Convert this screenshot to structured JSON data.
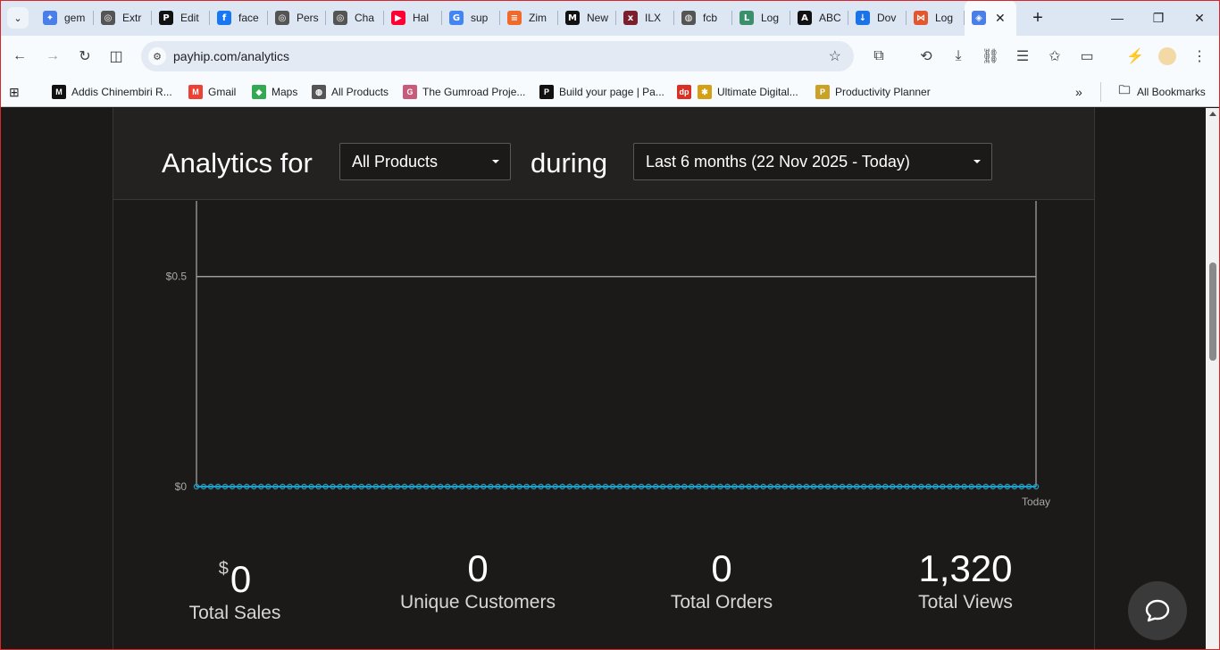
{
  "browser": {
    "tabs": [
      {
        "label": "gem",
        "icon": "gemini-icon",
        "color": "#4a7fe8",
        "glyph": "✦"
      },
      {
        "label": "Extr",
        "icon": "chatgpt-icon",
        "color": "#555",
        "glyph": "◎"
      },
      {
        "label": "Edit",
        "icon": "payhip-icon",
        "color": "#111",
        "glyph": "P"
      },
      {
        "label": "face",
        "icon": "facebook-icon",
        "color": "#1877f2",
        "glyph": "f"
      },
      {
        "label": "Pers",
        "icon": "chatgpt-icon",
        "color": "#555",
        "glyph": "◎"
      },
      {
        "label": "Cha",
        "icon": "chatgpt-icon",
        "color": "#555",
        "glyph": "◎"
      },
      {
        "label": "Hal",
        "icon": "youtube-icon",
        "color": "#ff0033",
        "glyph": "▶"
      },
      {
        "label": "sup",
        "icon": "google-icon",
        "color": "#4285f4",
        "glyph": "G"
      },
      {
        "label": "Zim",
        "icon": "zim-icon",
        "color": "#f06a2b",
        "glyph": "≡"
      },
      {
        "label": "New",
        "icon": "medium-icon",
        "color": "#111",
        "glyph": "M"
      },
      {
        "label": "ILX",
        "icon": "ilx-icon",
        "color": "#7a1f2b",
        "glyph": "x"
      },
      {
        "label": "fcb",
        "icon": "globe-icon",
        "color": "#555",
        "glyph": "◍"
      },
      {
        "label": "Log",
        "icon": "login-icon",
        "color": "#3b8f6a",
        "glyph": "L"
      },
      {
        "label": "ABC",
        "icon": "abc-icon",
        "color": "#111",
        "glyph": "A"
      },
      {
        "label": "Dov",
        "icon": "download-icon",
        "color": "#1a73e8",
        "glyph": "↓"
      },
      {
        "label": "Log",
        "icon": "bowtie-icon",
        "color": "#e4572e",
        "glyph": "⋈"
      }
    ],
    "active_tab_icon": "payhip-shield-icon",
    "url": "payhip.com/analytics",
    "bookmarks": [
      {
        "label": "Addis Chinembiri R...",
        "icon": "medium-icon",
        "color": "#111",
        "glyph": "M"
      },
      {
        "label": "Gmail",
        "icon": "gmail-icon",
        "color": "#ea4335",
        "glyph": "M"
      },
      {
        "label": "Maps",
        "icon": "maps-icon",
        "color": "#34a853",
        "glyph": "◆"
      },
      {
        "label": "All Products",
        "icon": "globe-icon",
        "color": "#555",
        "glyph": "◍"
      },
      {
        "label": "The Gumroad Proje...",
        "icon": "gumroad-icon",
        "color": "#c85a7a",
        "glyph": "G"
      },
      {
        "label": "Build your page | Pa...",
        "icon": "payhip-icon",
        "color": "#111",
        "glyph": "P"
      },
      {
        "label": "",
        "icon": "dp-icon",
        "color": "#d93025",
        "glyph": "dp"
      },
      {
        "label": "Ultimate Digital...",
        "icon": "sparkle-icon",
        "color": "#d4a017",
        "glyph": "✱"
      },
      {
        "label": "Productivity Planner",
        "icon": "planner-icon",
        "color": "#c9a227",
        "glyph": "P"
      }
    ],
    "all_bookmarks": "All Bookmarks"
  },
  "header": {
    "title": "Analytics for",
    "product_select": "All Products",
    "during": "during",
    "period_select": "Last 6 months (22 Nov 2025 - Today)"
  },
  "chart_data": {
    "type": "line",
    "title": "",
    "xlabel": "",
    "ylabel": "",
    "y_ticks": [
      "$0",
      "$0.5"
    ],
    "ylim": [
      0,
      0.68
    ],
    "x_tick_label": "Today",
    "points": 118,
    "series": [
      {
        "values": "all 0"
      }
    ],
    "color": "#1fa0c8",
    "grid": true
  },
  "stats": {
    "sales_currency": "$",
    "sales_value": "0",
    "sales_label": "Total Sales",
    "customers_value": "0",
    "customers_label": "Unique Customers",
    "orders_value": "0",
    "orders_label": "Total Orders",
    "views_value": "1,320",
    "views_label": "Total Views"
  }
}
